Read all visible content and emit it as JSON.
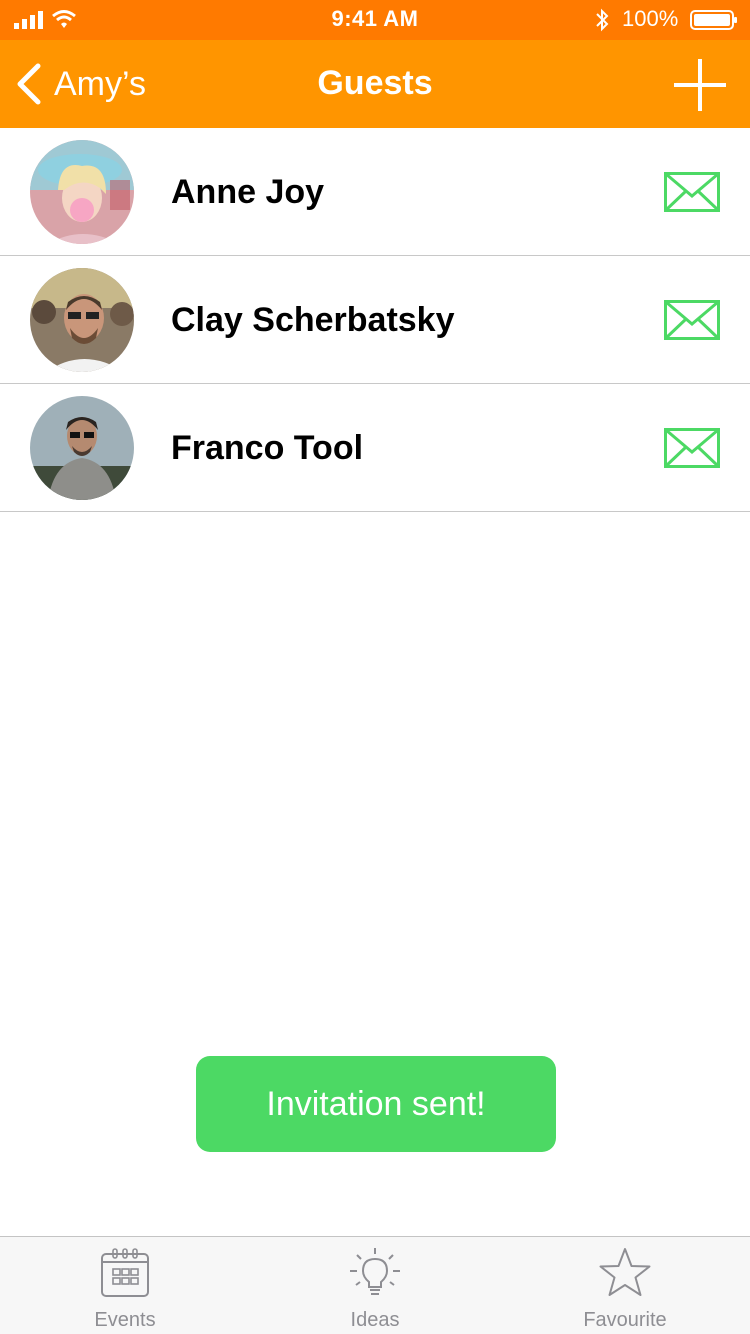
{
  "status_bar": {
    "time": "9:41 AM",
    "battery": "100%",
    "icons": [
      "signal-icon",
      "wifi-icon",
      "bluetooth-icon",
      "battery-icon"
    ]
  },
  "nav": {
    "back_label": "Amy’s",
    "title": "Guests",
    "back_icon": "chevron-left-icon",
    "add_icon": "plus-icon"
  },
  "guests": [
    {
      "name": "Anne Joy",
      "invite_icon": "envelope-icon"
    },
    {
      "name": "Clay Scherbatsky",
      "invite_icon": "envelope-icon"
    },
    {
      "name": "Franco Tool",
      "invite_icon": "envelope-icon"
    }
  ],
  "toast": {
    "message": "Invitation sent!"
  },
  "tabs": [
    {
      "label": "Events",
      "icon": "calendar-icon"
    },
    {
      "label": "Ideas",
      "icon": "lightbulb-icon"
    },
    {
      "label": "Favourite",
      "icon": "star-icon"
    }
  ],
  "colors": {
    "status_bar": "#ff7a00",
    "nav_bar": "#ff9500",
    "accent_green": "#4cd964",
    "tab_inactive": "#8e8e93",
    "divider": "#c8c8c8"
  }
}
